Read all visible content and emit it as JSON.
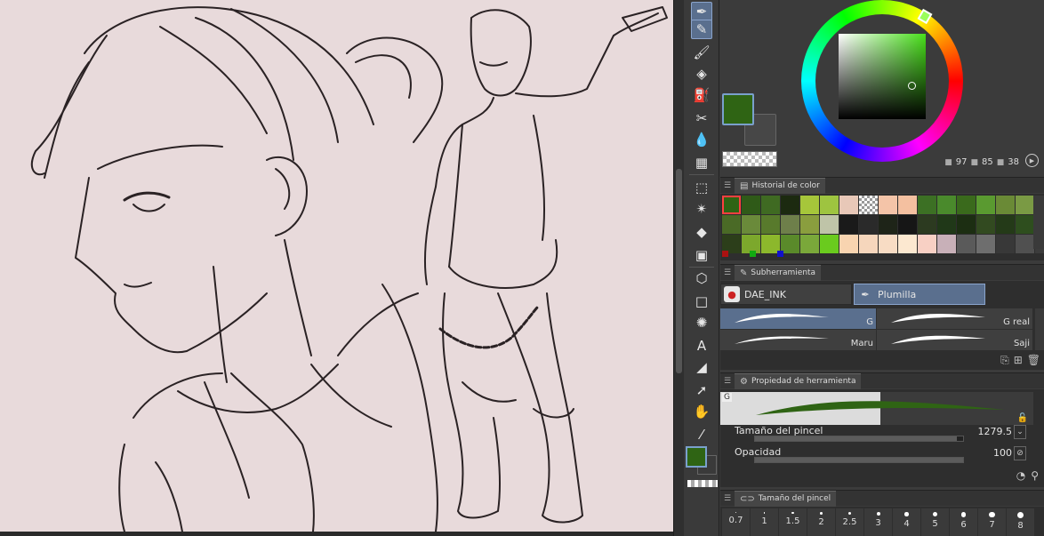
{
  "canvas": {
    "background": "#e8dadb"
  },
  "color_wheel": {
    "main_color": "#2f6414",
    "sub_color": "#474747",
    "hue_color": "#48e01a"
  },
  "hsv": {
    "h": "97",
    "s": "85",
    "v": "38"
  },
  "color_history": {
    "title": "Historial de color",
    "swatches": [
      "#2f6414",
      "#2f5a18",
      "#3f6a22",
      "#1c2a10",
      "#a6c63a",
      "#9ec440",
      "#e8c8b8",
      "checker",
      "#f4c4a8",
      "#f4c0a0",
      "#3c7024",
      "#4a8a2c",
      "#3a6a1c",
      "#5a9a30",
      "#6a8a36",
      "#7a9a44",
      "#5a7a30",
      "#4a6a26",
      "#6a8a3a",
      "#587a2c",
      "#6e7f4a",
      "#8a9e3e",
      "#bfc4a8",
      "#1a1a1a",
      "#2a2a2a",
      "#1e2418",
      "#161616",
      "#2c3a20",
      "#203818",
      "#1c2e12",
      "#324a20",
      "#243a18",
      "#2e4e1e",
      "#5a7c2c",
      "#2c3e1a",
      "#7ca82c",
      "#8cb82c",
      "#5a8a2a",
      "#7aa83a",
      "#6acb1e",
      "#f8d4b0",
      "#f6d6bc",
      "#f8dcc4",
      "#fce8d0",
      "#f8d0c4",
      "#c8b0b8",
      "#5a5a5a",
      "#6e6e6e",
      "#383838",
      "#505050",
      "#3c3c3c"
    ],
    "dots": [
      "#aa1111",
      "#11aa11",
      "#1111cc"
    ]
  },
  "subtool": {
    "title": "Subherramienta",
    "groups": [
      {
        "label": "DAE_INK",
        "icon": "ink-bottle-icon"
      },
      {
        "label": "Plumilla",
        "icon": "pen-nib-icon"
      }
    ],
    "brushes": [
      {
        "label": "G"
      },
      {
        "label": "G real"
      },
      {
        "label": "Maru"
      },
      {
        "label": "Saji"
      }
    ]
  },
  "tool_property": {
    "title": "Propiedad de herramienta",
    "preview_label": "G",
    "brush_size": {
      "label": "Tamaño del pincel",
      "value": "1279.5",
      "fill": 0.97
    },
    "opacity": {
      "label": "Opacidad",
      "value": "100",
      "fill": 1.0
    }
  },
  "brush_size_panel": {
    "title": "Tamaño del pincel",
    "sizes": [
      "0.7",
      "1",
      "1.5",
      "2",
      "2.5",
      "3",
      "4",
      "5",
      "6",
      "7",
      "8"
    ]
  }
}
